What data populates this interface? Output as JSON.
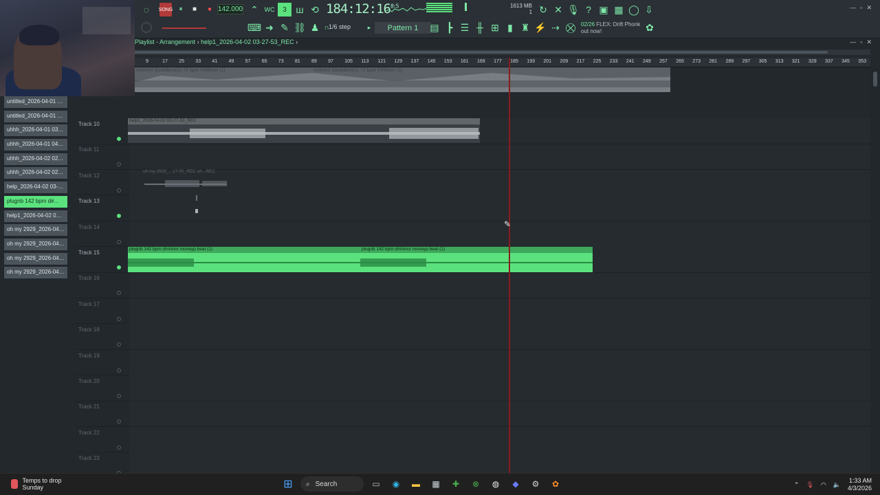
{
  "toolbar": {
    "tempo": "142.000",
    "time_main": "184:12:16",
    "time_sup": "8:5",
    "memory_line1": "1613 MB",
    "memory_line2": "1",
    "step_label": "1/6 step",
    "pattern_label": "Pattern 1",
    "news_date": "02/26",
    "news_line1": "FLEX: Drift Phonk",
    "news_line2": "out now!"
  },
  "playlist": {
    "title": "Playlist - Arrangement",
    "breadcrumb_sep": "›",
    "project": "help1_2026-04-02 03-27-53_REC",
    "ruler": [
      "9",
      "17",
      "25",
      "33",
      "41",
      "49",
      "57",
      "65",
      "73",
      "81",
      "89",
      "97",
      "105",
      "113",
      "121",
      "129",
      "137",
      "145",
      "153",
      "161",
      "169",
      "177",
      "185",
      "193",
      "201",
      "209",
      "217",
      "225",
      "233",
      "241",
      "249",
      "257",
      "265",
      "273",
      "281",
      "289",
      "297",
      "305",
      "313",
      "321",
      "329",
      "337",
      "345",
      "353"
    ],
    "overview_labels": [
      "motive3 (beatdemo)1 72 bpm F#Minor (1)",
      "motive3 (beatdemo)1 72 bpm F#Minor (1)"
    ]
  },
  "picker": [
    "untitled_2026-04-01 01-...",
    "untitled_2026-04-01 02-...",
    "uhhh_2026-04-01 03-53...",
    "uhhh_2026-04-01 04-30...",
    "uhhh_2026-04-02 02-11...",
    "uhhh_2026-04-02 02-40...",
    "help_2026-04-02 03-02...",
    "plugnb 142 bpm d#...",
    "help1_2026-04-02 03-2...",
    "oh my 2929_2026-04-03...",
    "oh my 2929_2026-04-03...",
    "oh my 2929_2026-04-03...",
    "oh my 2929_2026-04-03..."
  ],
  "tracks": [
    {
      "label": "Track 10"
    },
    {
      "label": "Track 11"
    },
    {
      "label": "Track 12"
    },
    {
      "label": "Track 13"
    },
    {
      "label": "Track 14"
    },
    {
      "label": "Track 15"
    },
    {
      "label": "Track 16"
    },
    {
      "label": "Track 17"
    },
    {
      "label": "Track 18"
    },
    {
      "label": "Track 19"
    },
    {
      "label": "Track 20"
    },
    {
      "label": "Track 21"
    },
    {
      "label": "Track 22"
    },
    {
      "label": "Track 23"
    }
  ],
  "clips": {
    "help1": "help1_2026-04-02 03-27-53_REC",
    "ohmy_a": "oh my 2929_...17-00_REC",
    "ohmy_b": "oh...REC",
    "plugnb_a": "plugnb 142 bpm d#minor moneyp beat (1)",
    "plugnb_b": "plugnb 142 bpm d#minor moneyp beat (1)"
  },
  "taskbar": {
    "weather_line1": "Temps to drop",
    "weather_line2": "Sunday",
    "search_label": "Search",
    "time": "1:33 AM",
    "date": "4/3/2026"
  },
  "colors": {
    "accent": "#5be27e",
    "playhead": "#8a1d1d",
    "record": "#ff4b4b"
  }
}
